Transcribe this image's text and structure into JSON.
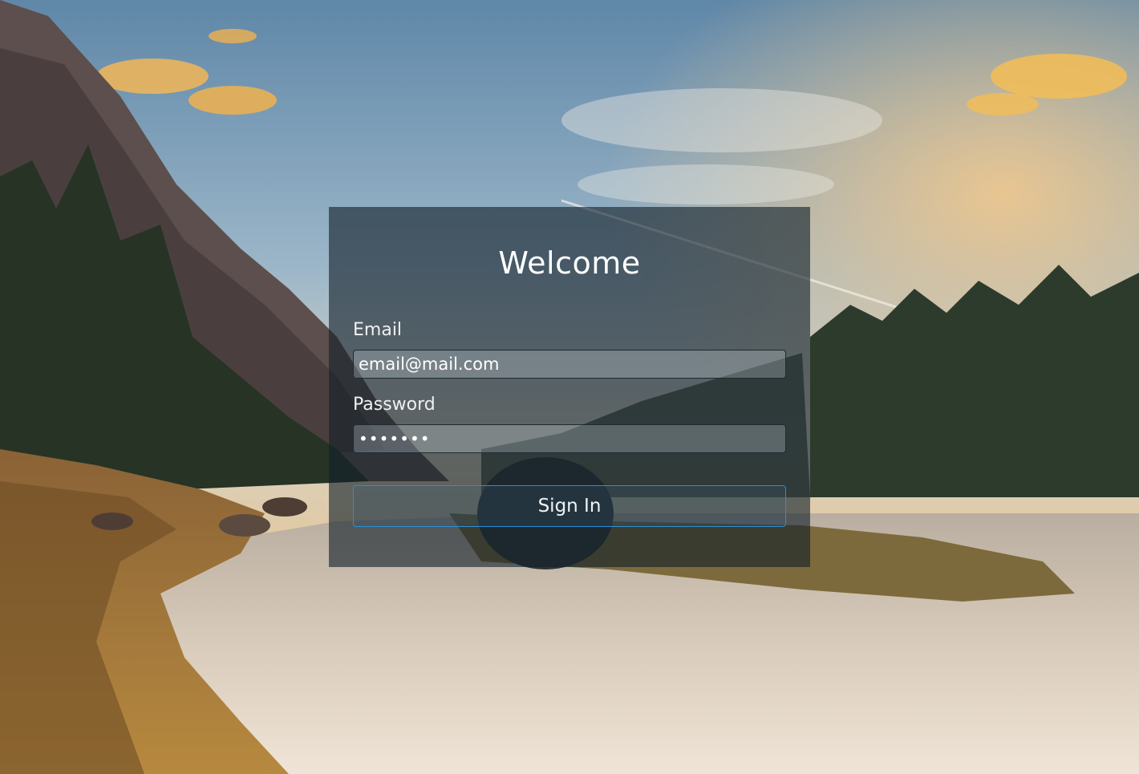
{
  "login": {
    "title": "Welcome",
    "email_label": "Email",
    "email_value": "email@mail.com",
    "password_label": "Password",
    "password_value": "•••••••",
    "signin_label": "Sign In"
  },
  "colors": {
    "card_overlay": "#14202a",
    "button_border": "#2b8fd6",
    "text": "#ffffff"
  }
}
